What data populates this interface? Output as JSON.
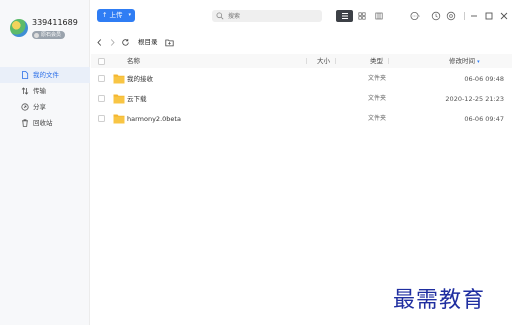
{
  "user": {
    "name": "339411689",
    "badge": "原石会员"
  },
  "sidebar": {
    "items": [
      {
        "label": "我的文件",
        "icon": "file-icon",
        "active": true
      },
      {
        "label": "传输",
        "icon": "transfer-icon",
        "active": false
      },
      {
        "label": "分享",
        "icon": "share-icon",
        "active": false
      },
      {
        "label": "回收站",
        "icon": "trash-icon",
        "active": false
      }
    ]
  },
  "toolbar": {
    "upload_label": "上传",
    "upload_caret": "▾",
    "search_placeholder": "搜索"
  },
  "breadcrumb": {
    "current": "根目录"
  },
  "table": {
    "columns": {
      "name": "名称",
      "size": "大小",
      "type": "类型",
      "modified": "修改时间",
      "sort_arrow": "▾"
    },
    "rows": [
      {
        "name": "我的接收",
        "size": "",
        "type": "文件夹",
        "modified": "06-06 09:48"
      },
      {
        "name": "云下载",
        "size": "",
        "type": "文件夹",
        "modified": "2020-12-25 21:23"
      },
      {
        "name": "harmony2.0beta",
        "size": "",
        "type": "文件夹",
        "modified": "06-06 09:47"
      }
    ]
  },
  "watermark": "最需教育",
  "colors": {
    "accent": "#2f7df4",
    "folder": "#f5b730",
    "active_bg": "#e9eff9",
    "watermark": "#1f2ea0"
  }
}
